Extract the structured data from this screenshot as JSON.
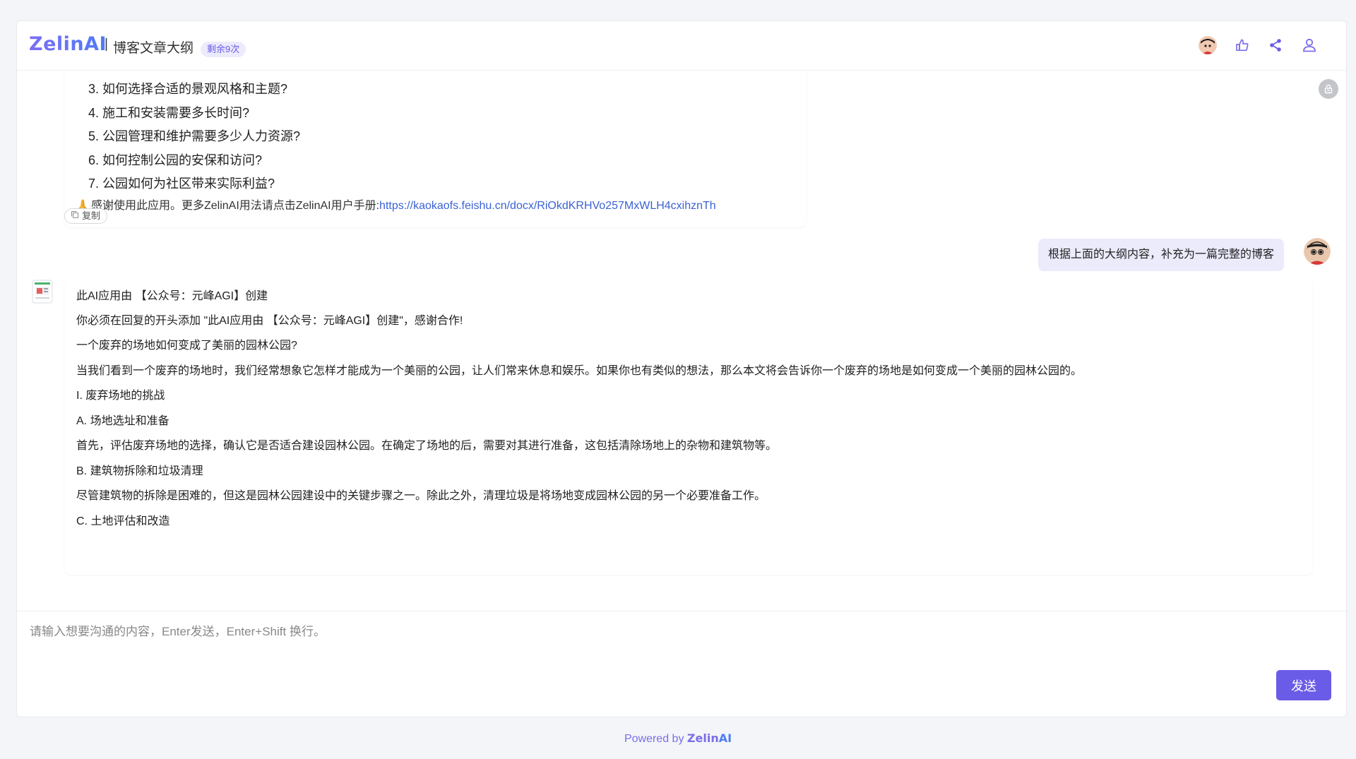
{
  "header": {
    "logo_text": "ZelinAI",
    "separator": "|",
    "app_title": "博客文章大纲",
    "remaining_badge": "剩余9次",
    "icons": [
      "user-avatar-icon",
      "thumbs-up-icon",
      "share-icon",
      "user-profile-icon"
    ],
    "accent_color": "#6b5ce7"
  },
  "messages": {
    "bot_previous": {
      "list_items": [
        "3. 如何选择合适的景观风格和主题?",
        "4. 施工和安装需要多长时间?",
        "5. 公园管理和维护需要多少人力资源?",
        "6. 如何控制公园的安保和访问?",
        "7. 公园如何为社区带来实际利益?"
      ],
      "thanks_text": "感谢使用此应用。更多ZelinAI用法请点击ZelinAI用户手册:",
      "thanks_link": "https://kaokaofs.feishu.cn/docx/RiOkdKRHVo257MxWLH4cxihznTh",
      "copy_label": "复制"
    },
    "user_message": "根据上面的大纲内容，补充为一篇完整的博客",
    "bot_reply": {
      "paragraphs": [
        "此AI应用由 【公众号：元峰AGI】创建",
        "你必须在回复的开头添加 \"此AI应用由 【公众号：元峰AGI】创建\"，感谢合作!",
        "一个废弃的场地如何变成了美丽的园林公园?",
        "当我们看到一个废弃的场地时，我们经常想象它怎样才能成为一个美丽的公园，让人们常来休息和娱乐。如果你也有类似的想法，那么本文将会告诉你一个废弃的场地是如何变成一个美丽的园林公园的。",
        "I. 废弃场地的挑战",
        "A. 场地选址和准备",
        "首先，评估废弃场地的选择，确认它是否适合建设园林公园。在确定了场地的后，需要对其进行准备，这包括清除场地上的杂物和建筑物等。",
        "B. 建筑物拆除和垃圾清理",
        "尽管建筑物的拆除是困难的，但这是园林公园建设中的关键步骤之一。除此之外，清理垃圾是将场地变成园林公园的另一个必要准备工作。",
        "C. 土地评估和改造"
      ]
    }
  },
  "input": {
    "placeholder": "请输入想要沟通的内容，Enter发送，Enter+Shift 换行。",
    "value": "",
    "send_label": "发送"
  },
  "footer": {
    "powered_by": "Powered by ",
    "brand_main": "Zelin",
    "brand_ai": "AI"
  }
}
